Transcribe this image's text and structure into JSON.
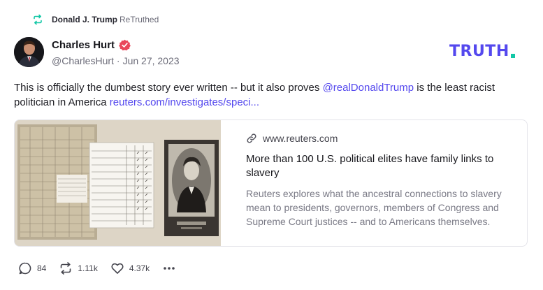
{
  "retruth": {
    "user": "Donald J. Trump",
    "label": "ReTruthed"
  },
  "author": {
    "name": "Charles Hurt",
    "handle": "@CharlesHurt",
    "separator": "·",
    "date": "Jun 27, 2023"
  },
  "brand": {
    "logo_text": "TRUTH",
    "logo_color": "#5448ee",
    "dot_color": "#12c7a6"
  },
  "post": {
    "text_before": "This is officially the dumbest story ever written -- but it also proves ",
    "mention": "@realDonaldTrump",
    "text_after": " is the least racist politician in America ",
    "link": "reuters.com/investigates/speci..."
  },
  "card": {
    "domain": "www.reuters.com",
    "title": "More than 100 U.S. political elites have family links to slavery",
    "description": "Reuters explores what the ancestral connections to slavery mean to presidents, governors, members of Congress and Supreme Court justices -- and to Americans themselves."
  },
  "actions": {
    "replies": "84",
    "retruths": "1.11k",
    "likes": "4.37k"
  },
  "colors": {
    "accent": "#5448ee",
    "retruth_green": "#12c7a6",
    "verified": "#e9465b"
  }
}
